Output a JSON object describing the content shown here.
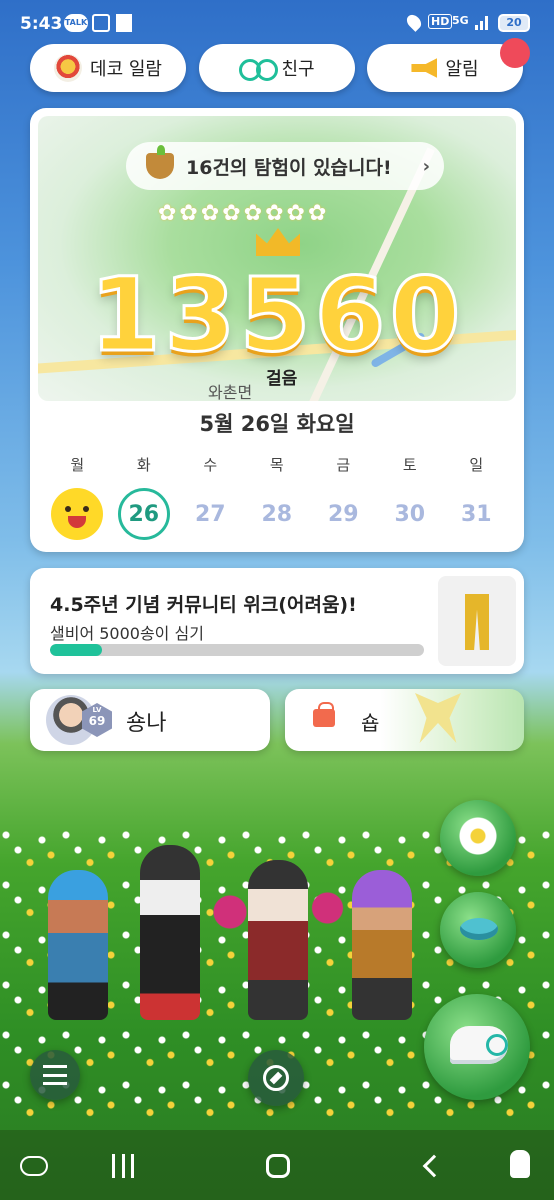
{
  "status_bar": {
    "time": "5:43",
    "icons": [
      "talk-icon",
      "scan-icon",
      "page-icon",
      "location-icon",
      "hd-icon",
      "5g-icon",
      "signal-icon"
    ],
    "hd_label": "HD",
    "network_label": "5G",
    "battery": "20"
  },
  "top_buttons": {
    "deco": {
      "label": "데코 일람",
      "icon": "deco-icon"
    },
    "friend": {
      "label": "친구",
      "icon": "friend-icon"
    },
    "alarm": {
      "label": "알림",
      "icon": "megaphone-icon"
    }
  },
  "main_card": {
    "expedition_text": "16건의 탐험이 있습니다!",
    "expedition_chevron": "›",
    "steps": "13560",
    "steps_unit": "걸음",
    "place_name": "와촌면",
    "date_title": "5월 26일 화요일",
    "weekdays": [
      "월",
      "화",
      "수",
      "목",
      "금",
      "토",
      "일"
    ],
    "days": [
      "",
      "26",
      "27",
      "28",
      "29",
      "30",
      "31"
    ]
  },
  "mission": {
    "title": "4.5주년 기념 커뮤니티 위크(어려움)!",
    "subtitle": "샐비어 5000송이 심기",
    "progress_fraction": 0.14,
    "progress_color": "#1fc29a",
    "reward_icon": "pants-icon"
  },
  "profile": {
    "nickname": "숑나",
    "level_prefix": "LV",
    "level": "69"
  },
  "shop": {
    "label": "숍"
  },
  "colors": {
    "accent": "#1fc29a",
    "step_number": "#ffd23c",
    "alert_dot": "#ef4a5a"
  }
}
